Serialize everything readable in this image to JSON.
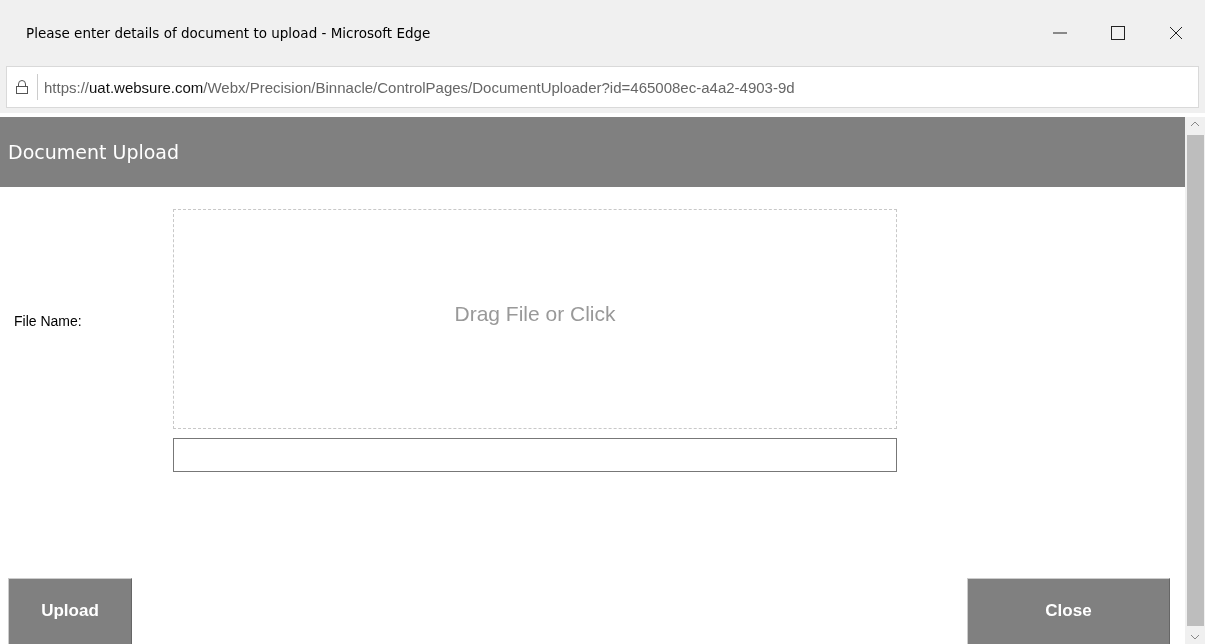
{
  "window": {
    "title": "Please enter details of document to upload - Microsoft Edge"
  },
  "address_bar": {
    "url_prefix": "https://",
    "url_host": "uat.websure.com",
    "url_path": "/Webx/Precision/Binnacle/ControlPages/DocumentUploader?id=465008ec-a4a2-4903-9d"
  },
  "header": {
    "title": "Document Upload"
  },
  "form": {
    "label": "File Name:",
    "drop_zone": "Drag File or Click"
  },
  "buttons": [
    "Upload",
    "Close"
  ]
}
